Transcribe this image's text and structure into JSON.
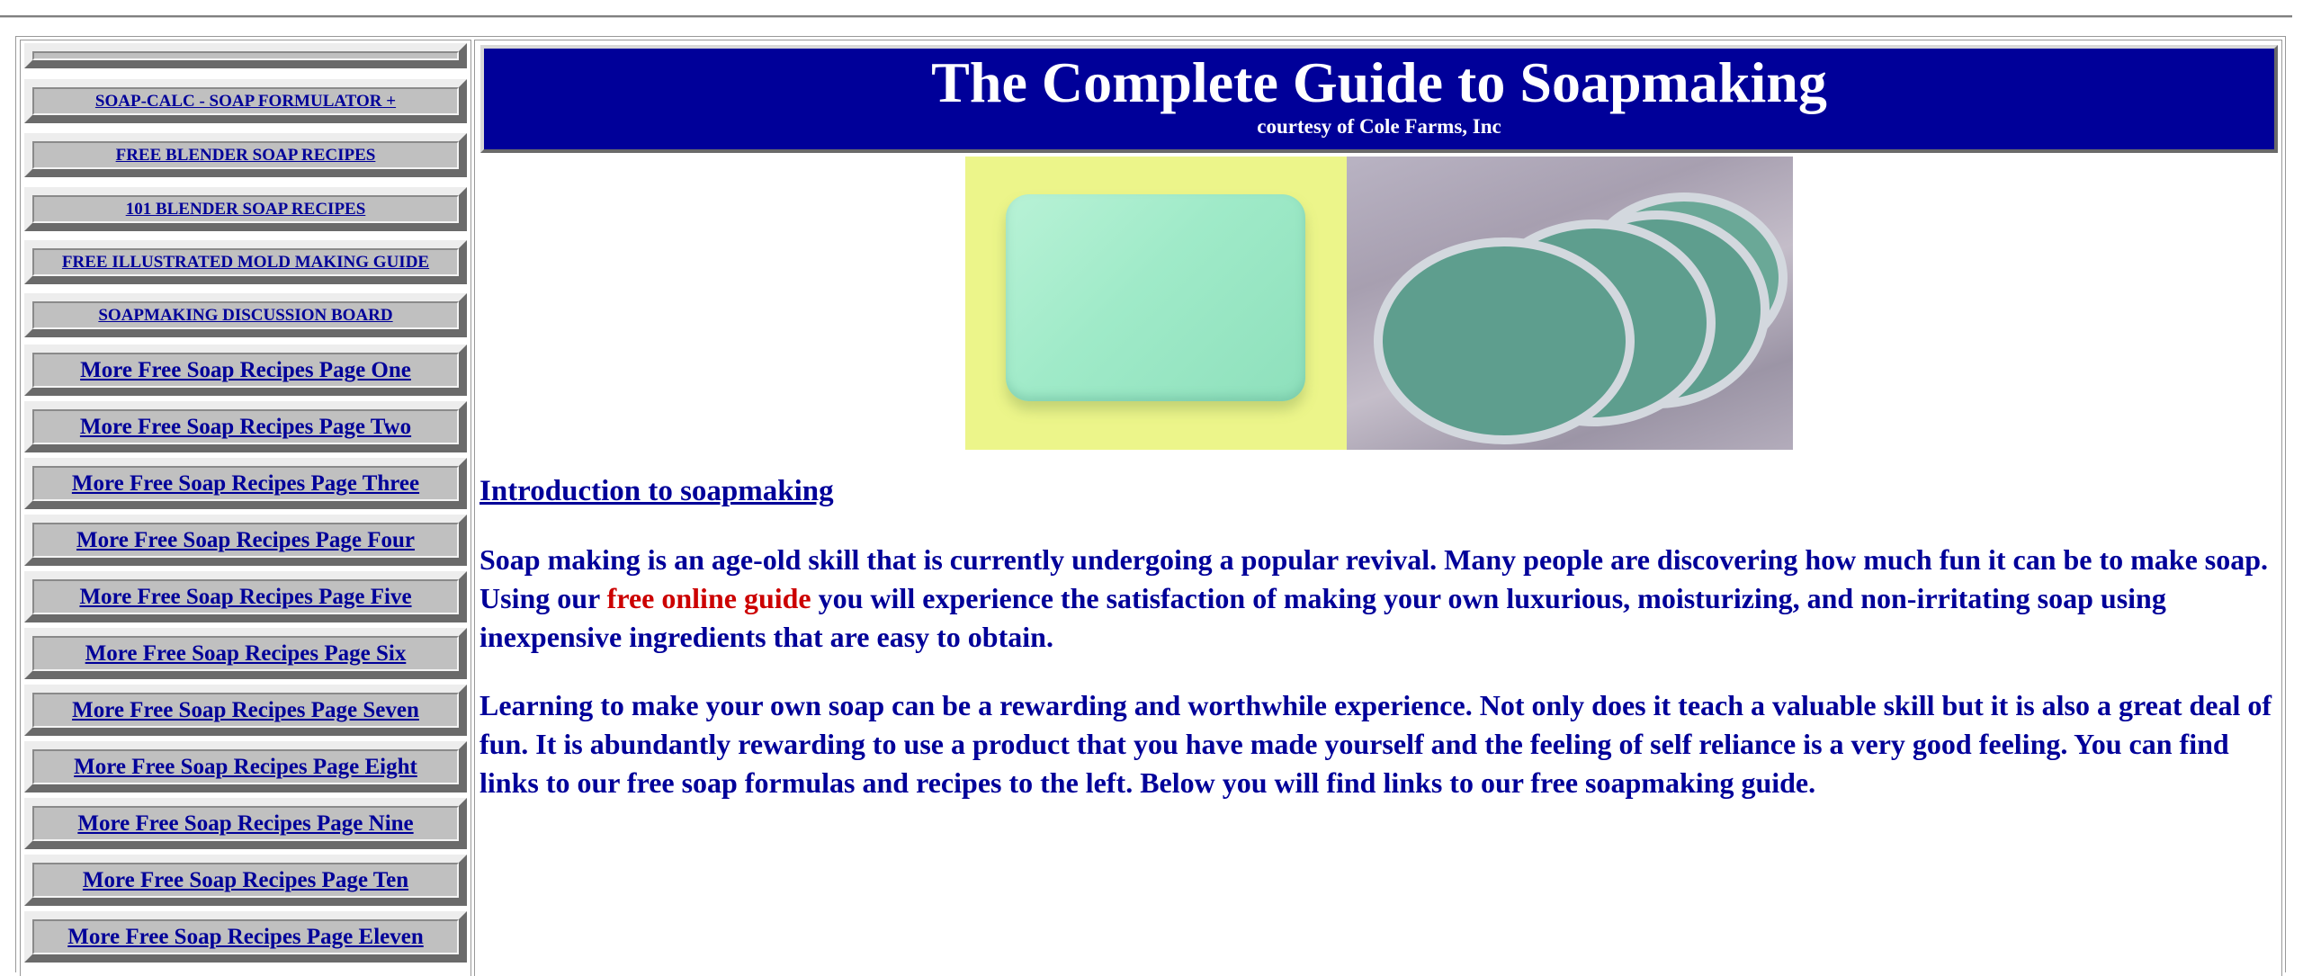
{
  "sidebar": {
    "items": [
      {
        "label": ""
      },
      {
        "label": "SOAP-CALC - SOAP FORMULATOR +"
      },
      {
        "label": "FREE BLENDER SOAP RECIPES"
      },
      {
        "label": "101 BLENDER SOAP RECIPES"
      },
      {
        "label": "FREE ILLUSTRATED MOLD MAKING GUIDE"
      },
      {
        "label": "SOAPMAKING DISCUSSION BOARD"
      },
      {
        "label": "More Free Soap Recipes Page One"
      },
      {
        "label": "More Free Soap Recipes Page Two"
      },
      {
        "label": "More Free Soap Recipes Page Three"
      },
      {
        "label": "More Free Soap Recipes Page Four"
      },
      {
        "label": "More Free Soap Recipes Page Five"
      },
      {
        "label": "More Free Soap Recipes Page Six"
      },
      {
        "label": "More Free Soap Recipes Page Seven"
      },
      {
        "label": "More Free Soap Recipes Page Eight"
      },
      {
        "label": "More Free Soap Recipes Page Nine"
      },
      {
        "label": "More Free Soap Recipes Page Ten"
      },
      {
        "label": "More Free Soap Recipes Page Eleven"
      }
    ]
  },
  "header": {
    "title": "The Complete Guide to Soapmaking",
    "subtitle": "courtesy of Cole Farms, Inc"
  },
  "main": {
    "intro_link": "Introduction to soapmaking",
    "para1_before": "Soap making is an age-old skill that is currently undergoing a popular revival. Many people are discovering how much fun it can be to make soap. Using our ",
    "para1_link": "free online guide",
    "para1_after": " you will experience the satisfaction of making your own luxurious, moisturizing, and non-irritating soap using inexpensive ingredients that are easy to obtain.",
    "para2": "Learning to make your own soap can be a rewarding and worthwhile experience. Not only does it teach a valuable skill but it is also a great deal of fun. It is abundantly rewarding to use a product that you have made yourself and the feeling of self reliance is a very good feeling. You can find links to our free soap formulas and recipes to the left. Below you will find links to our free soapmaking guide."
  },
  "colors": {
    "banner_bg": "#000099",
    "text": "#000099",
    "highlight_link": "#cc0000",
    "button_face": "#c0c0c0"
  }
}
